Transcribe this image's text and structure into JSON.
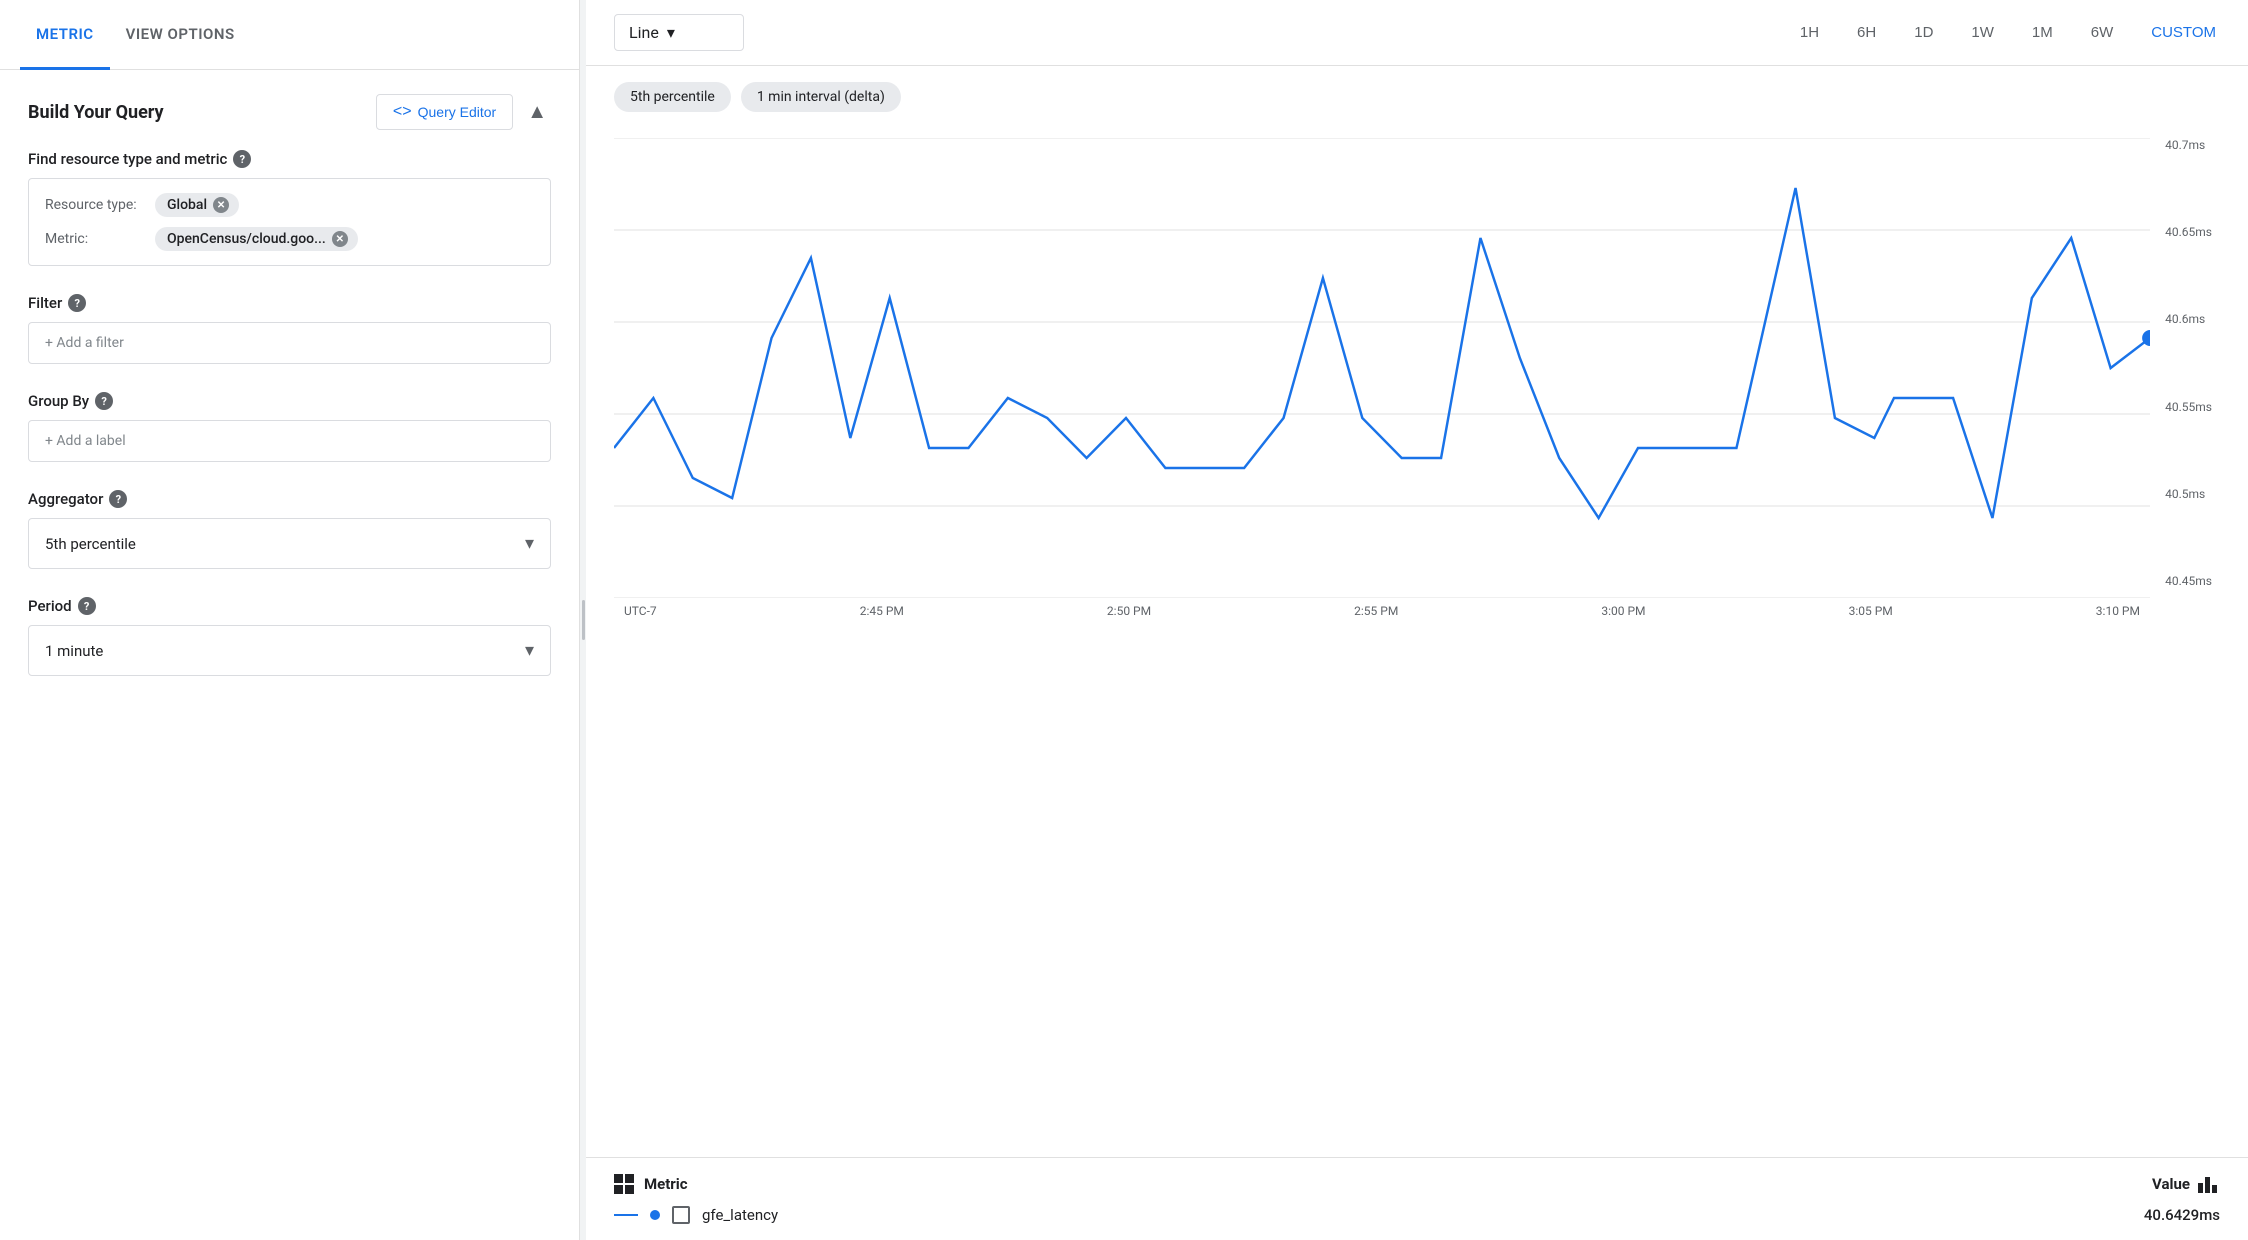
{
  "tabs": [
    {
      "id": "metric",
      "label": "METRIC",
      "active": true
    },
    {
      "id": "view-options",
      "label": "VIEW OPTIONS",
      "active": false
    }
  ],
  "panel": {
    "section_title": "Build Your Query",
    "query_editor_btn": "Query Editor",
    "collapse_icon": "▲",
    "find_resource_label": "Find resource type and metric",
    "resource_type_label": "Resource type:",
    "resource_type_value": "Global",
    "metric_label": "Metric:",
    "metric_value": "OpenCensus/cloud.goo...",
    "filter_label": "Filter",
    "filter_placeholder": "+ Add a filter",
    "group_by_label": "Group By",
    "group_by_placeholder": "+ Add a label",
    "aggregator_label": "Aggregator",
    "aggregator_value": "5th percentile",
    "period_label": "Period",
    "period_value": "1 minute"
  },
  "chart": {
    "type": "Line",
    "time_ranges": [
      "1H",
      "6H",
      "1D",
      "1W",
      "1M",
      "6W",
      "CUSTOM"
    ],
    "active_time_range": "CUSTOM",
    "chips": [
      "5th percentile",
      "1 min interval (delta)"
    ],
    "y_labels": [
      "40.7ms",
      "40.65ms",
      "40.6ms",
      "40.55ms",
      "40.5ms",
      "40.45ms"
    ],
    "x_labels": [
      "UTC-7",
      "2:45 PM",
      "2:50 PM",
      "2:55 PM",
      "3:00 PM",
      "3:05 PM",
      "3:10 PM"
    ],
    "legend": {
      "metric_col": "Metric",
      "value_col": "Value",
      "rows": [
        {
          "name": "gfe_latency",
          "value": "40.6429ms"
        }
      ]
    }
  }
}
